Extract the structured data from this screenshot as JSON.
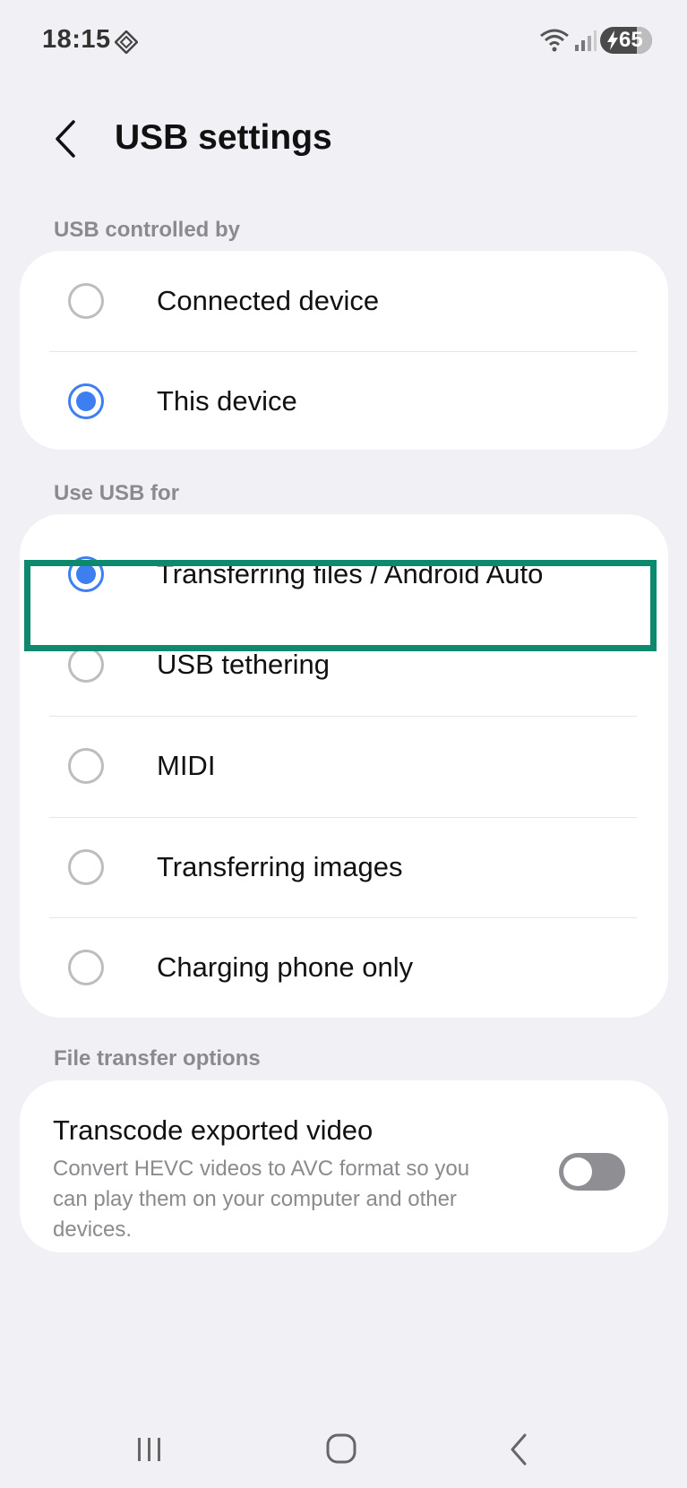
{
  "status_bar": {
    "time": "18:15",
    "battery_level": "65"
  },
  "header": {
    "title": "USB settings"
  },
  "controlled_by": {
    "label": "USB controlled by",
    "options": [
      {
        "label": "Connected device",
        "selected": false
      },
      {
        "label": "This device",
        "selected": true
      }
    ]
  },
  "use_usb_for": {
    "label": "Use USB for",
    "options": [
      {
        "label": "Transferring files / Android Auto",
        "selected": true
      },
      {
        "label": "USB tethering",
        "selected": false
      },
      {
        "label": "MIDI",
        "selected": false
      },
      {
        "label": "Transferring images",
        "selected": false
      },
      {
        "label": "Charging phone only",
        "selected": false
      }
    ]
  },
  "file_transfer_options": {
    "label": "File transfer options",
    "transcode": {
      "title": "Transcode exported video",
      "description": "Convert HEVC videos to AVC format so you can play them on your computer and other devices.",
      "enabled": false
    }
  },
  "colors": {
    "accent": "#3d7ff0",
    "highlight": "#0d8a6e",
    "background": "#f1f1f5"
  },
  "icons": [
    "back-arrow-icon",
    "recent-apps-icon",
    "home-icon",
    "nav-back-icon"
  ]
}
